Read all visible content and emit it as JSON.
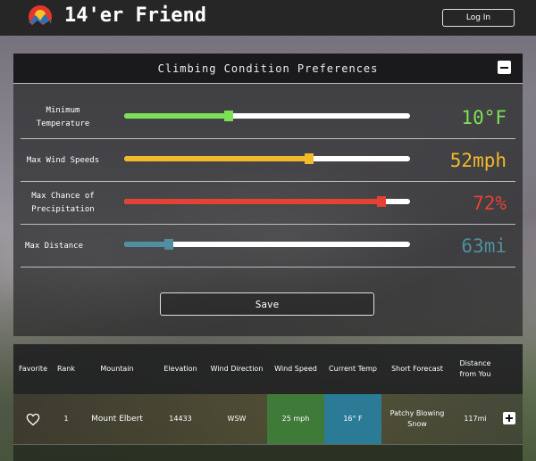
{
  "navbar": {
    "brand": "14'er Friend",
    "login_label": "Log In"
  },
  "preferences": {
    "title": "Climbing Condition Preferences",
    "rows": [
      {
        "label": "Minimum Temperature",
        "value_text": "10°F",
        "fraction": 0.365,
        "color": "#7be255"
      },
      {
        "label": "Max Wind Speeds",
        "value_text": "52mph",
        "fraction": 0.648,
        "color": "#f2b92b"
      },
      {
        "label": "Max Chance of Precipitation",
        "value_text": "72%",
        "fraction": 0.9,
        "color": "#e64233"
      },
      {
        "label": "Max Distance",
        "value_text": "63mi",
        "fraction": 0.155,
        "color": "#4f8fa0"
      }
    ],
    "save_label": "Save"
  },
  "table": {
    "headers": [
      "Favorite",
      "Rank",
      "Mountain",
      "Elevation",
      "Wind Direction",
      "Wind Speed",
      "Current Temp",
      "Short Forecast",
      "Distance from You"
    ],
    "rows": [
      {
        "rank": "1",
        "mountain": "Mount Elbert",
        "elevation": "14433",
        "wind_direction": "WSW",
        "wind_speed": "25 mph",
        "current_temp": "16° F",
        "short_forecast": "Patchy Blowing Snow",
        "distance": "117mi"
      }
    ]
  }
}
